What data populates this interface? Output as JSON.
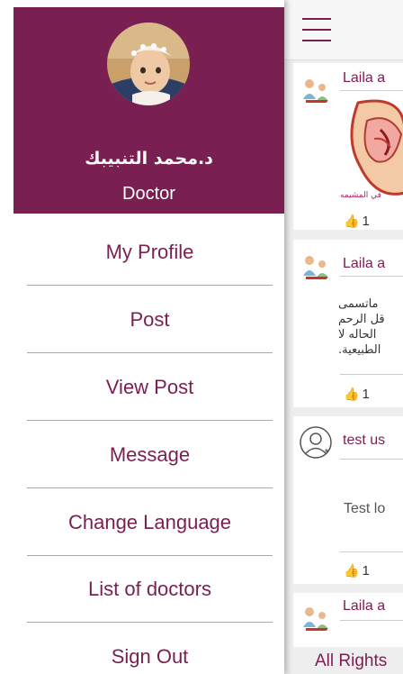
{
  "drawer": {
    "user_name": "د.محمد التنبيبك",
    "user_role": "Doctor",
    "menu": [
      {
        "label": "My Profile"
      },
      {
        "label": "Post"
      },
      {
        "label": "View Post"
      },
      {
        "label": "Message"
      },
      {
        "label": "Change Language"
      },
      {
        "label": "List of doctors"
      },
      {
        "label": "Sign Out"
      }
    ]
  },
  "feed": {
    "posts": [
      {
        "author": "Laila a",
        "likes": "1",
        "image_caption": "في المشيمه"
      },
      {
        "author": "Laila a",
        "likes": "1",
        "lines": [
          "ماتسمى",
          "قل الرحم",
          "الحاله لا",
          "الطبيعية."
        ]
      },
      {
        "author": "test us",
        "likes": "1",
        "text": "Test lo"
      },
      {
        "author": "Laila a"
      }
    ],
    "footer": "All Rights"
  },
  "colors": {
    "brand": "#7a1f52",
    "divider": "#a8a8a8",
    "feed_background": "#eeeeee"
  }
}
